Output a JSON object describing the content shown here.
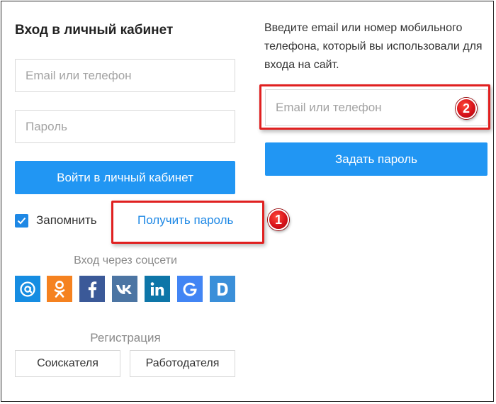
{
  "login": {
    "title": "Вход в личный кабинет",
    "login_placeholder": "Email или телефон",
    "password_placeholder": "Пароль",
    "submit_label": "Войти в личный кабинет",
    "remember_label": "Запомнить",
    "remember_checked": true,
    "get_password_label": "Получить пароль"
  },
  "social": {
    "heading": "Вход через соцсети",
    "buttons": [
      {
        "icon": "at-sign-icon",
        "glyph": "@",
        "color": "#168de2"
      },
      {
        "icon": "odnoklassniki-icon",
        "glyph": "ok",
        "color": "#f58220"
      },
      {
        "icon": "facebook-icon",
        "glyph": "f",
        "color": "#3b5998"
      },
      {
        "icon": "vk-icon",
        "glyph": "vk",
        "color": "#4c75a3"
      },
      {
        "icon": "linkedin-icon",
        "glyph": "in",
        "color": "#0e76a8"
      },
      {
        "icon": "google-icon",
        "glyph": "G",
        "color": "#4285f4"
      },
      {
        "icon": "d-icon",
        "glyph": "D",
        "color": "#3a8fd9"
      }
    ]
  },
  "registration": {
    "heading": "Регистрация",
    "job_seeker_label": "Соискателя",
    "employer_label": "Работодателя"
  },
  "reset": {
    "instruction": "Введите email или номер мобильного телефона, который вы использовали для входа на сайт.",
    "login_placeholder": "Email или телефон",
    "submit_label": "Задать пароль"
  },
  "annotations": {
    "marker_1": "1",
    "marker_2": "2",
    "highlight_color": "#e02020"
  }
}
